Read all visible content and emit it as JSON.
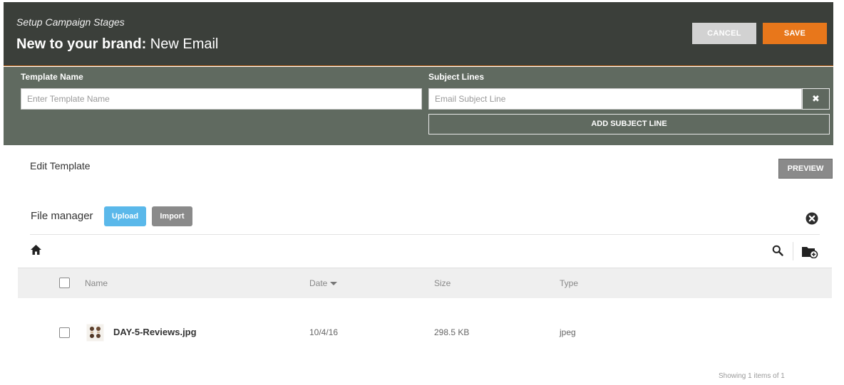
{
  "header": {
    "subtitle": "Setup Campaign Stages",
    "title_bold": "New to your brand:",
    "title_rest": " New Email",
    "cancel_label": "CANCEL",
    "save_label": "SAVE"
  },
  "form": {
    "template_name_label": "Template Name",
    "template_name_placeholder": "Enter Template Name",
    "subject_lines_label": "Subject Lines",
    "subject_placeholder": "Email Subject Line",
    "clear_glyph": "✖",
    "add_subject_label": "ADD SUBJECT LINE"
  },
  "editor": {
    "label": "Edit Template",
    "preview_label": "PREVIEW"
  },
  "file_manager": {
    "label": "File manager",
    "upload_label": "Upload",
    "import_label": "Import",
    "columns": {
      "name": "Name",
      "date": "Date",
      "size": "Size",
      "type": "Type"
    },
    "sort": {
      "column": "date",
      "direction": "descending"
    },
    "files": [
      {
        "name": "DAY-5-Reviews.jpg",
        "date": "10/4/16",
        "size": "298.5 KB",
        "type": "jpeg"
      }
    ],
    "footer": "Showing 1 items of 1"
  },
  "icons": {
    "close": "close-circle-icon",
    "home": "home-icon",
    "search": "search-icon",
    "new_folder": "new-folder-icon",
    "file_thumb": "image-thumbnail-icon"
  },
  "colors": {
    "header_bg": "#3b3f3a",
    "form_band_bg": "#606a60",
    "accent_orange": "#e8771b",
    "upload_blue": "#5ab8ea",
    "gray_button": "#8a8a8a"
  }
}
